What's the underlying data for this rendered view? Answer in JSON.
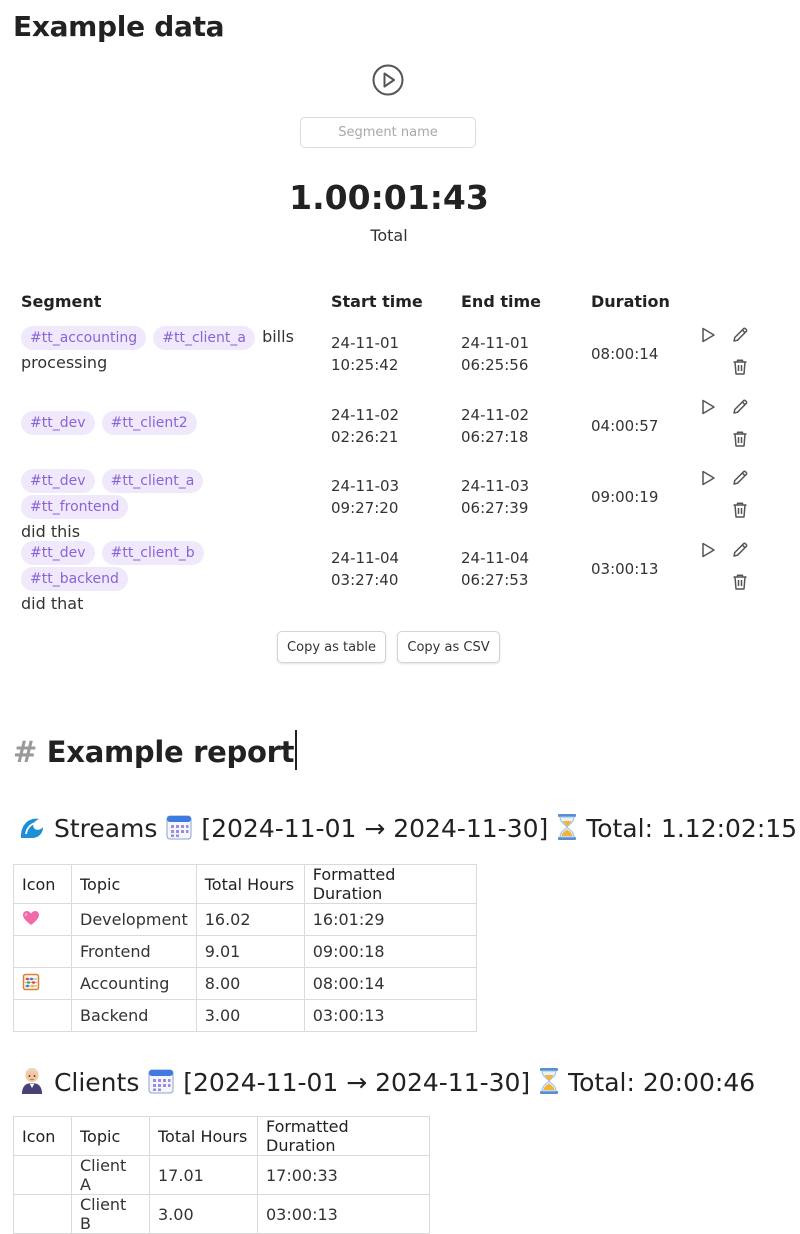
{
  "title": "Example data",
  "timer": {
    "segment_placeholder": "Segment name",
    "total_time": "1.00:01:43",
    "total_label": "Total"
  },
  "segments": {
    "headers": {
      "segment": "Segment",
      "start": "Start time",
      "end": "End time",
      "duration": "Duration"
    },
    "rows": [
      {
        "tags": [
          "#tt_accounting",
          "#tt_client_a"
        ],
        "text_inline": "bills",
        "text_after": "processing",
        "start_date": "24-11-01",
        "start_time": "10:25:42",
        "end_date": "24-11-01",
        "end_time": "06:25:56",
        "duration": "08:00:14"
      },
      {
        "tags": [
          "#tt_dev",
          "#tt_client2"
        ],
        "text_inline": "",
        "text_after": "",
        "start_date": "24-11-02",
        "start_time": "02:26:21",
        "end_date": "24-11-02",
        "end_time": "06:27:18",
        "duration": "04:00:57"
      },
      {
        "tags": [
          "#tt_dev",
          "#tt_client_a",
          "#tt_frontend"
        ],
        "text_inline": "",
        "text_after": "did this",
        "start_date": "24-11-03",
        "start_time": "09:27:20",
        "end_date": "24-11-03",
        "end_time": "06:27:39",
        "duration": "09:00:19"
      },
      {
        "tags": [
          "#tt_dev",
          "#tt_client_b",
          "#tt_backend"
        ],
        "text_inline": "",
        "text_after": "did that",
        "start_date": "24-11-04",
        "start_time": "03:27:40",
        "end_date": "24-11-04",
        "end_time": "06:27:53",
        "duration": "03:00:13"
      }
    ],
    "copy_table_label": "Copy as table",
    "copy_csv_label": "Copy as CSV"
  },
  "report": {
    "heading_hash": "#",
    "heading": "Example report",
    "streams": {
      "title": "Streams",
      "icon": "wave-icon",
      "range": "[2024-11-01 → 2024-11-30]",
      "total": "Total: 1.12:02:15",
      "headers": [
        "Icon",
        "Topic",
        "Total Hours",
        "Formatted Duration"
      ],
      "rows": [
        {
          "icon": "pink-heart-icon",
          "topic": "Development",
          "hours": "16.02",
          "formatted": "16:01:29"
        },
        {
          "icon": "",
          "topic": "Frontend",
          "hours": "9.01",
          "formatted": "09:00:18"
        },
        {
          "icon": "abacus-icon",
          "topic": "Accounting",
          "hours": "8.00",
          "formatted": "08:00:14"
        },
        {
          "icon": "",
          "topic": "Backend",
          "hours": "3.00",
          "formatted": "03:00:13"
        }
      ]
    },
    "clients": {
      "title": "Clients",
      "icon": "person-icon",
      "range": "[2024-11-01 → 2024-11-30]",
      "total": "Total: 20:00:46",
      "headers": [
        "Icon",
        "Topic",
        "Total Hours",
        "Formatted Duration"
      ],
      "rows": [
        {
          "icon": "",
          "topic": "Client A",
          "hours": "17.01",
          "formatted": "17:00:33"
        },
        {
          "icon": "",
          "topic": "Client B",
          "hours": "3.00",
          "formatted": "03:00:13"
        }
      ]
    }
  },
  "colors": {
    "tag_bg": "#efe9fb",
    "tag_text": "#8b63d6"
  }
}
